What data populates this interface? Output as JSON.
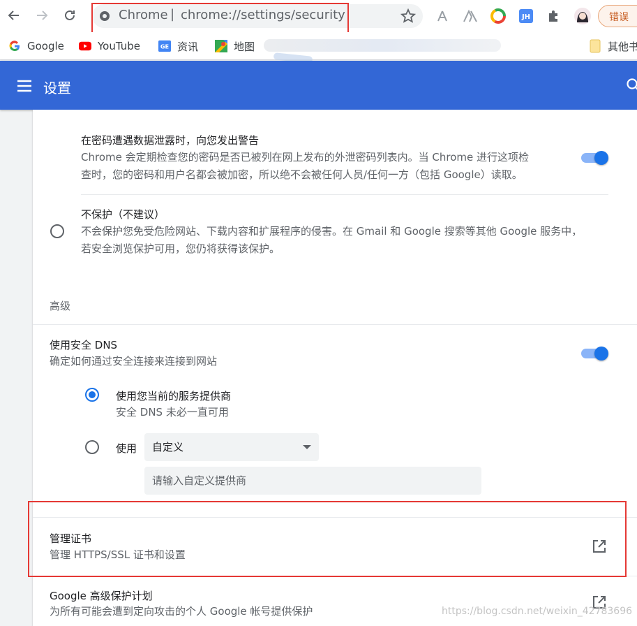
{
  "browser": {
    "omnibox": {
      "site_label": "Chrome",
      "separator": "|",
      "url": "chrome://settings/security"
    },
    "profile_button": "错误",
    "bookmarks": [
      {
        "label": "Google",
        "icon": "google-icon"
      },
      {
        "label": "YouTube",
        "icon": "youtube-icon"
      },
      {
        "label": "资讯",
        "icon": "news-icon"
      },
      {
        "label": "地图",
        "icon": "maps-icon"
      }
    ],
    "bookmarks_more": "»",
    "other_bookmarks": "其他书签"
  },
  "header": {
    "title": "设置"
  },
  "sections": {
    "password_warning": {
      "title": "在密码遭遇数据泄露时，向您发出警告",
      "description_line1": "Chrome 会定期检查您的密码是否已被列在网上发布的外泄密码列表内。当 Chrome 进行这项检",
      "description_line2": "查时，您的密码和用户名都会被加密，所以绝不会被任何人员/任何一方（包括 Google）读取。",
      "enabled": true
    },
    "no_protection": {
      "title": "不保护（不建议）",
      "description_line1": "不会保护您免受危险网站、下载内容和扩展程序的侵害。在 Gmail 和 Google 搜索等其他 Google 服务中，",
      "description_line2": "若安全浏览保护可用，您仍将获得该保护。",
      "selected": false
    },
    "advanced_heading": "高级",
    "secure_dns": {
      "title": "使用安全 DNS",
      "description": "确定如何通过安全连接来连接到网站",
      "enabled": true,
      "option_current": {
        "title": "使用您当前的服务提供商",
        "description": "安全 DNS 未必一直可用",
        "selected": true
      },
      "option_custom": {
        "label": "使用",
        "select_value": "自定义",
        "input_placeholder": "请输入自定义提供商",
        "selected": false
      }
    },
    "manage_certificates": {
      "title": "管理证书",
      "description": "管理 HTTPS/SSL 证书和设置"
    },
    "advanced_protection": {
      "title": "Google 高级保护计划",
      "description": "为所有可能会遭到定向攻击的个人 Google 帐号提供保护"
    }
  },
  "watermark": "https://blog.csdn.net/weixin_42783696",
  "colors": {
    "header_bg": "#3367d6",
    "accent": "#1a73e8",
    "highlight_red": "#e53935"
  }
}
